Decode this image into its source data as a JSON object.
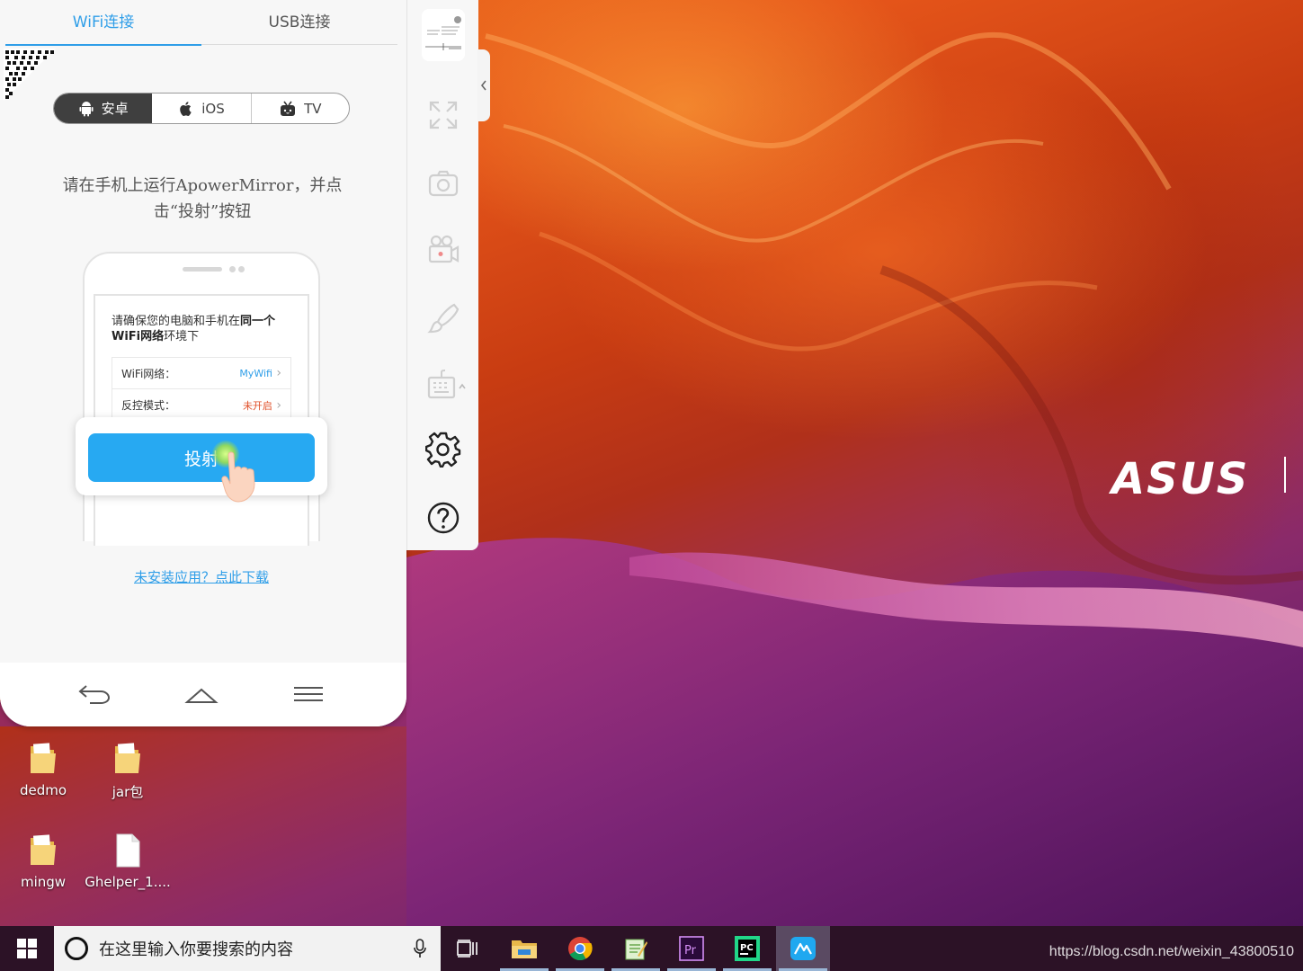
{
  "mirror": {
    "tabs": {
      "wifi": "WiFi连接",
      "usb": "USB连接"
    },
    "os_options": [
      {
        "label": "安卓",
        "icon": "android-icon",
        "active": true
      },
      {
        "label": "iOS",
        "icon": "apple-icon",
        "active": false
      },
      {
        "label": "TV",
        "icon": "tv-icon",
        "active": false
      }
    ],
    "instruction_line1": "请在手机上运行ApowerMirror，并点",
    "instruction_line2": "击“投射”按钮",
    "phone": {
      "message_prefix": "请确保您的电脑和手机在",
      "message_bold1": "同一个",
      "message_bold2": "WiFi网络",
      "message_suffix": "环境下",
      "wifi_label": "WiFi网络：",
      "wifi_value": "MyWifi",
      "control_label": "反控模式：",
      "control_value": "未开启",
      "cast_button": "投射"
    },
    "download_link": "未安装应用？点此下载"
  },
  "toolbar": {
    "tools": [
      "fullscreen-icon",
      "screenshot-icon",
      "record-icon",
      "whiteboard-icon",
      "keyboard-icon",
      "settings-icon",
      "help-icon"
    ]
  },
  "desktop": {
    "brand": "ASUS",
    "icons": [
      {
        "label": "dedmo",
        "type": "folder"
      },
      {
        "label": "jar包",
        "type": "folder"
      },
      {
        "label": "mingw",
        "type": "folder"
      },
      {
        "label": "Ghelper_1....",
        "type": "file"
      }
    ]
  },
  "taskbar": {
    "search_placeholder": "在这里输入你要搜索的内容",
    "apps": [
      "file-explorer-icon",
      "chrome-icon",
      "notepad-icon",
      "premiere-icon",
      "pycharm-icon",
      "apowermirror-icon"
    ],
    "active_app": "apowermirror-icon"
  },
  "watermark": "https://blog.csdn.net/weixin_43800510",
  "colors": {
    "accent": "#2f9ee8",
    "cast_button": "#27a9f2",
    "warning": "#e0502a"
  }
}
